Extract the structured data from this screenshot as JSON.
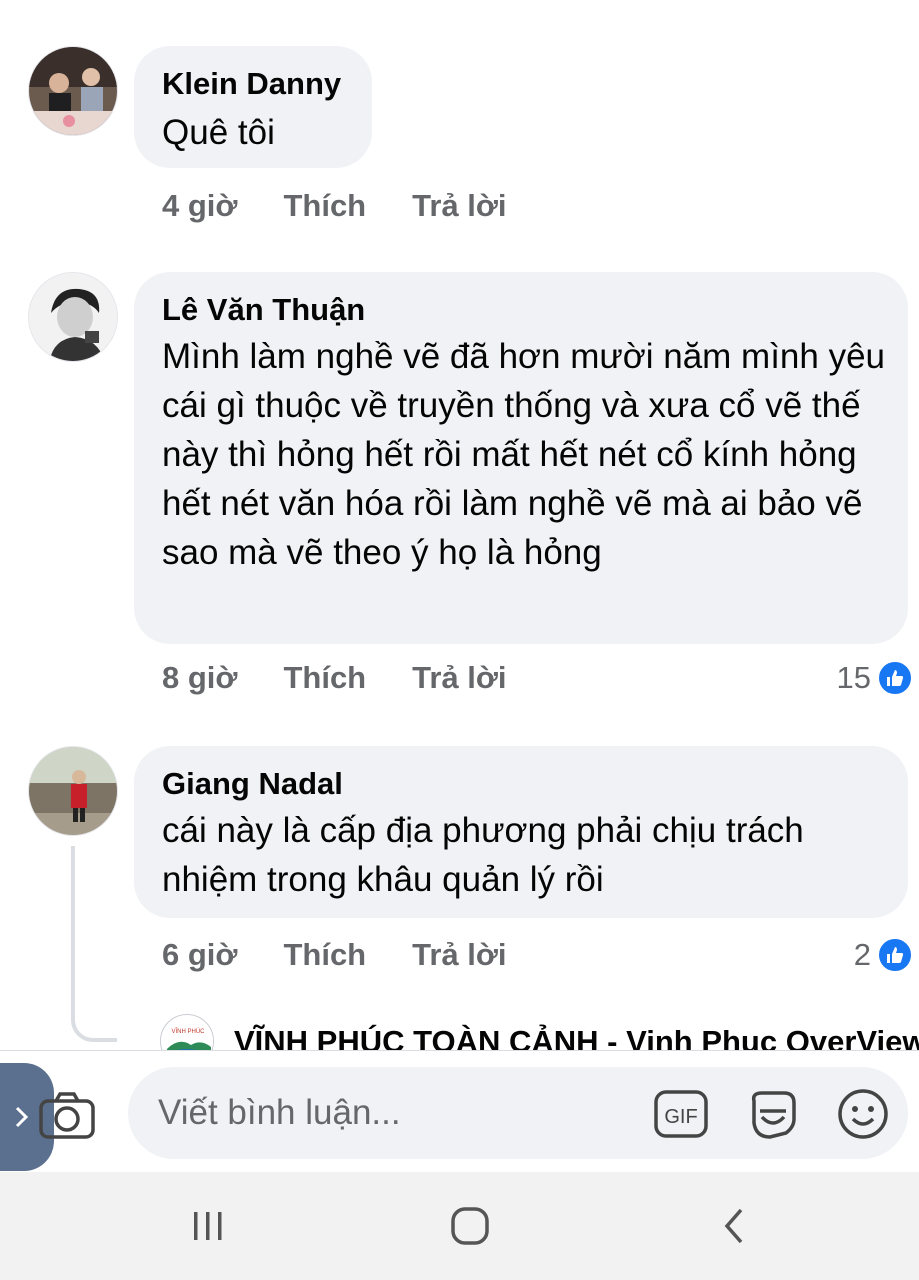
{
  "comments": [
    {
      "author": "Klein Danny",
      "text": "Quê tôi",
      "time": "4 giờ",
      "like_label": "Thích",
      "reply_label": "Trả lời",
      "reactions": null
    },
    {
      "author": "Lê Văn Thuận",
      "text": "Mình làm nghề vẽ đã hơn mười năm mình yêu cái gì thuộc về truyền thống và xưa cổ vẽ thế này thì hỏng hết rồi mất hết nét cổ kính hỏng hết nét văn hóa rồi làm nghề vẽ mà ai bảo vẽ sao mà vẽ theo ý họ là hỏng",
      "time": "8 giờ",
      "like_label": "Thích",
      "reply_label": "Trả lời",
      "reactions": "15"
    },
    {
      "author": "Giang Nadal",
      "text": "cái này là cấp địa phương phải chịu trách nhiệm trong khâu quản lý rồi",
      "time": "6 giờ",
      "like_label": "Thích",
      "reply_label": "Trả lời",
      "reactions": "2"
    }
  ],
  "reply_preview": {
    "page_name": "VĨNH PHÚC TOÀN CẢNH - Vinh Phuc OverView"
  },
  "composer": {
    "placeholder": "Viết bình luận...",
    "gif_label": "GIF"
  },
  "icons": {
    "like": "thumbs-up-icon",
    "camera": "camera-icon",
    "gif": "gif-icon",
    "sticker": "sticker-icon",
    "emoji": "emoji-icon",
    "nav_recent": "recent-apps-icon",
    "nav_home": "home-icon",
    "nav_back": "back-icon"
  },
  "colors": {
    "bubble": "#f0f2f5",
    "secondary_text": "#65676b",
    "like_blue": "#1877f2"
  }
}
